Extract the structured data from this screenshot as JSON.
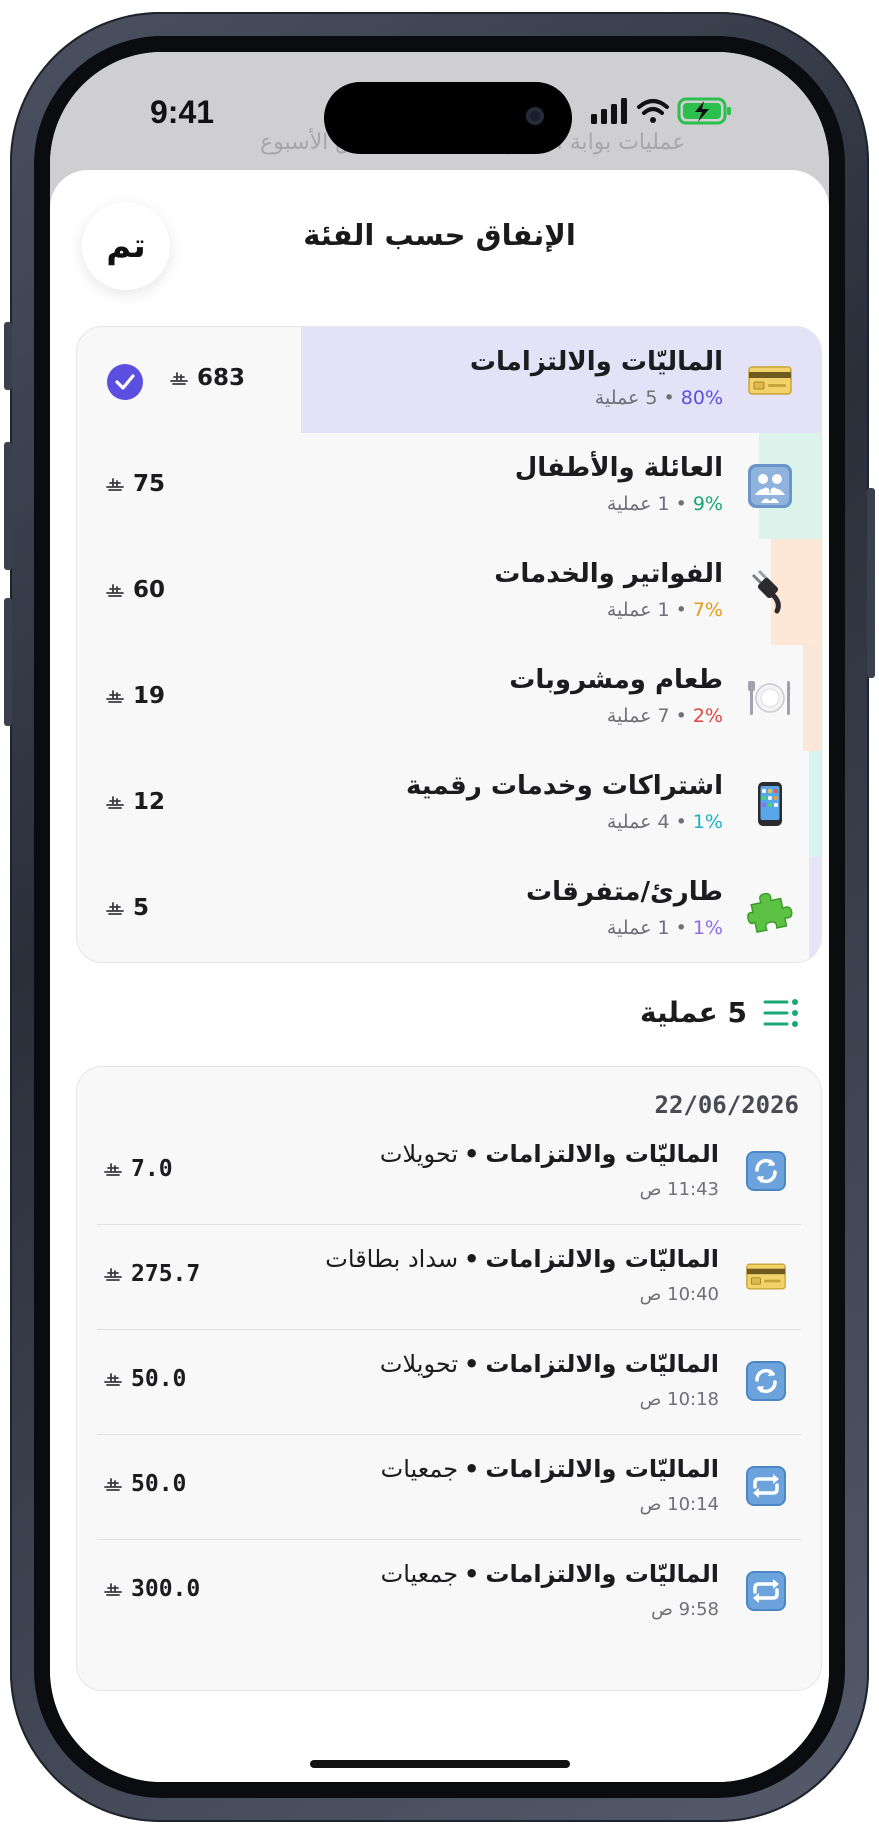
{
  "status_bar": {
    "time": "9:41"
  },
  "background": {
    "left_ghost": "إنفاق الأسبوع",
    "right_ghost": "عمليات بوابة الشهر"
  },
  "sheet": {
    "title": "الإنفاق حسب الفئة",
    "done_label": "تم"
  },
  "currency_symbol": "﷼",
  "categories": [
    {
      "name": "الماليّات والالتزامات",
      "percent": "80%",
      "count": "5 عملية",
      "amount": "683",
      "selected": true,
      "share": 0.8,
      "bar_color": "#e4e2f7",
      "percent_color": "#5b4fe0",
      "icon": "credit-card-icon"
    },
    {
      "name": "العائلة والأطفال",
      "percent": "9%",
      "count": "1 عملية",
      "amount": "75",
      "selected": false,
      "share": 0.09,
      "bar_color": "#dcf3ec",
      "percent_color": "#19a774",
      "icon": "family-icon"
    },
    {
      "name": "الفواتير والخدمات",
      "percent": "7%",
      "count": "1 عملية",
      "amount": "60",
      "selected": false,
      "share": 0.07,
      "bar_color": "#fde7d6",
      "percent_color": "#e59a18",
      "icon": "electric-plug-icon"
    },
    {
      "name": "طعام ومشروبات",
      "percent": "2%",
      "count": "7 عملية",
      "amount": "19",
      "selected": false,
      "share": 0.02,
      "bar_color": "#fbe7d7",
      "percent_color": "#e2453c",
      "icon": "plate-cutlery-icon"
    },
    {
      "name": "اشتراكات وخدمات رقمية",
      "percent": "1%",
      "count": "4 عملية",
      "amount": "12",
      "selected": false,
      "share": 0.01,
      "bar_color": "#d9f3ef",
      "percent_color": "#1ab3c4",
      "icon": "mobile-phone-icon"
    },
    {
      "name": "طارئ/متفرقات",
      "percent": "1%",
      "count": "1 عملية",
      "amount": "5",
      "selected": false,
      "share": 0.01,
      "bar_color": "#e7e4f7",
      "percent_color": "#8b6ce8",
      "icon": "puzzle-piece-icon"
    }
  ],
  "transactions_header": {
    "count_label": "5 عملية"
  },
  "transactions": {
    "date": "22/06/2026",
    "items": [
      {
        "category": "الماليّات والالتزامات",
        "subcategory": "تحويلات",
        "time": "11:43 ص",
        "amount": "7.0",
        "icon": "refresh-arrows-icon"
      },
      {
        "category": "الماليّات والالتزامات",
        "subcategory": "سداد بطاقات",
        "time": "10:40 ص",
        "amount": "275.7",
        "icon": "credit-card-icon"
      },
      {
        "category": "الماليّات والالتزامات",
        "subcategory": "تحويلات",
        "time": "10:18 ص",
        "amount": "50.0",
        "icon": "refresh-arrows-icon"
      },
      {
        "category": "الماليّات والالتزامات",
        "subcategory": "جمعيات",
        "time": "10:14 ص",
        "amount": "50.0",
        "icon": "repeat-arrows-icon"
      },
      {
        "category": "الماليّات والالتزامات",
        "subcategory": "جمعيات",
        "time": "9:58 ص",
        "amount": "300.0",
        "icon": "repeat-arrows-icon"
      }
    ]
  }
}
